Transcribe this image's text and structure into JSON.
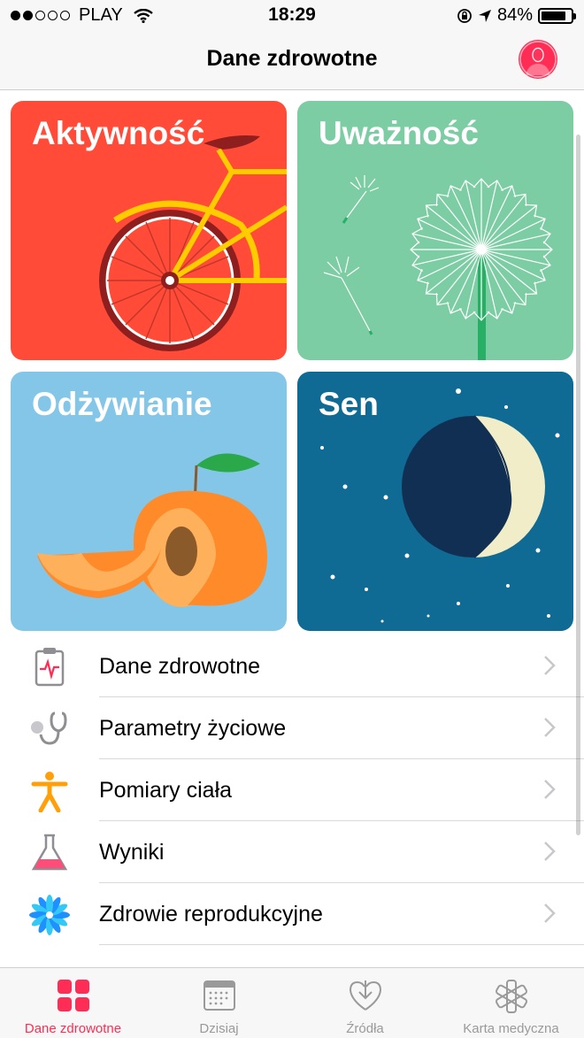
{
  "status_bar": {
    "carrier": "PLAY",
    "time": "18:29",
    "battery": "84%",
    "battery_level": 0.84
  },
  "nav": {
    "title": "Dane zdrowotne",
    "profile_icon": "person-icon"
  },
  "tiles": [
    {
      "title": "Aktywność",
      "color": "#ff4b38",
      "icon": "bicycle-icon"
    },
    {
      "title": "Uważność",
      "color": "#7ccca4",
      "icon": "dandelion-icon"
    },
    {
      "title": "Odżywianie",
      "color": "#84c6e8",
      "icon": "peach-icon"
    },
    {
      "title": "Sen",
      "color": "#0f6a94",
      "icon": "moon-icon"
    }
  ],
  "list": [
    {
      "label": "Dane zdrowotne",
      "icon": "clipboard-heartbeat-icon"
    },
    {
      "label": "Parametry życiowe",
      "icon": "stethoscope-icon"
    },
    {
      "label": "Pomiary ciała",
      "icon": "body-figure-icon"
    },
    {
      "label": "Wyniki",
      "icon": "flask-icon"
    },
    {
      "label": "Zdrowie reprodukcyjne",
      "icon": "flower-icon"
    }
  ],
  "tabs": [
    {
      "label": "Dane zdrowotne",
      "icon": "grid-icon",
      "active": true
    },
    {
      "label": "Dzisiaj",
      "icon": "calendar-icon",
      "active": false
    },
    {
      "label": "Źródła",
      "icon": "heart-download-icon",
      "active": false
    },
    {
      "label": "Karta medyczna",
      "icon": "asterisk-icon",
      "active": false
    }
  ],
  "colors": {
    "accent": "#ff2d55",
    "tab_inactive": "#9a9a9a"
  }
}
